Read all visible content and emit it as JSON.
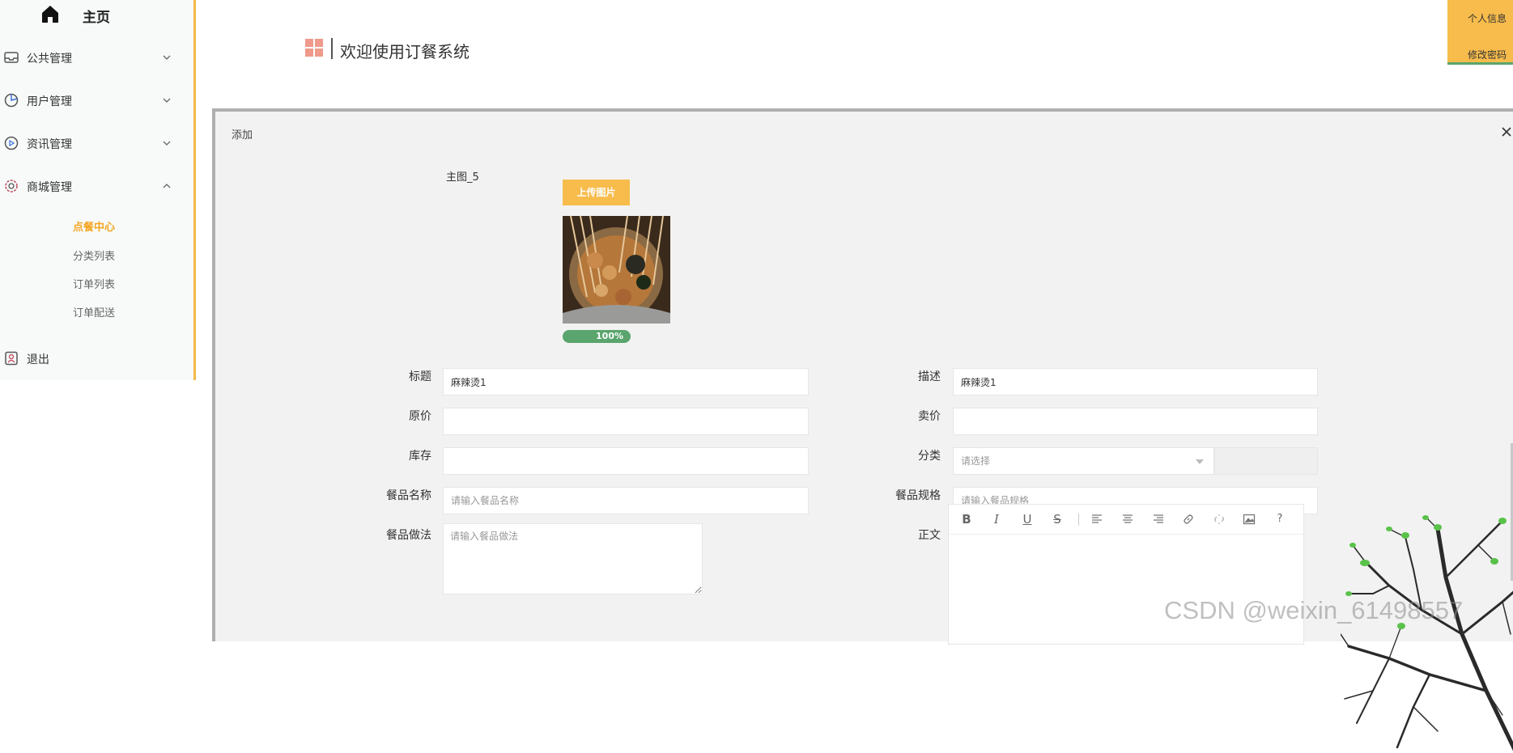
{
  "sidebar": {
    "home_label": "主页",
    "menu": [
      {
        "label": "公共管理",
        "expanded": false
      },
      {
        "label": "用户管理",
        "expanded": false
      },
      {
        "label": "资讯管理",
        "expanded": false
      },
      {
        "label": "商城管理",
        "expanded": true
      }
    ],
    "sub_items": [
      {
        "label": "点餐中心",
        "active": true
      },
      {
        "label": "分类列表",
        "active": false
      },
      {
        "label": "订单列表",
        "active": false
      },
      {
        "label": "订单配送",
        "active": false
      }
    ],
    "logout_label": "退出"
  },
  "header": {
    "title": "欢迎使用订餐系统",
    "user_menu": [
      "个人信息",
      "修改密码"
    ]
  },
  "dialog": {
    "title": "添加",
    "image_label": "主图_5",
    "upload_label": "上传图片",
    "progress_text": "100%",
    "progress_value": 100,
    "fields": {
      "title_label": "标题",
      "title_value": "麻辣烫1",
      "desc_label": "描述",
      "desc_value": "麻辣烫1",
      "orig_price_label": "原价",
      "orig_price_value": "",
      "sale_price_label": "卖价",
      "sale_price_value": "",
      "stock_label": "库存",
      "stock_value": "",
      "category_label": "分类",
      "category_placeholder": "请选择",
      "dish_name_label": "餐品名称",
      "dish_name_placeholder": "请输入餐品名称",
      "dish_spec_label": "餐品规格",
      "dish_spec_placeholder": "请输入餐品规格",
      "dish_method_label": "餐品做法",
      "dish_method_placeholder": "请输入餐品做法",
      "body_label": "正文"
    },
    "editor_toolbar": [
      "B",
      "I",
      "U",
      "S",
      "align-left",
      "align-center",
      "align-right",
      "link",
      "unlink",
      "image",
      "?"
    ]
  },
  "watermark": "CSDN @weixin_61498557",
  "colors": {
    "accent": "#f7bc4c",
    "active_text": "#f5a623",
    "progress": "#5aa56d"
  }
}
